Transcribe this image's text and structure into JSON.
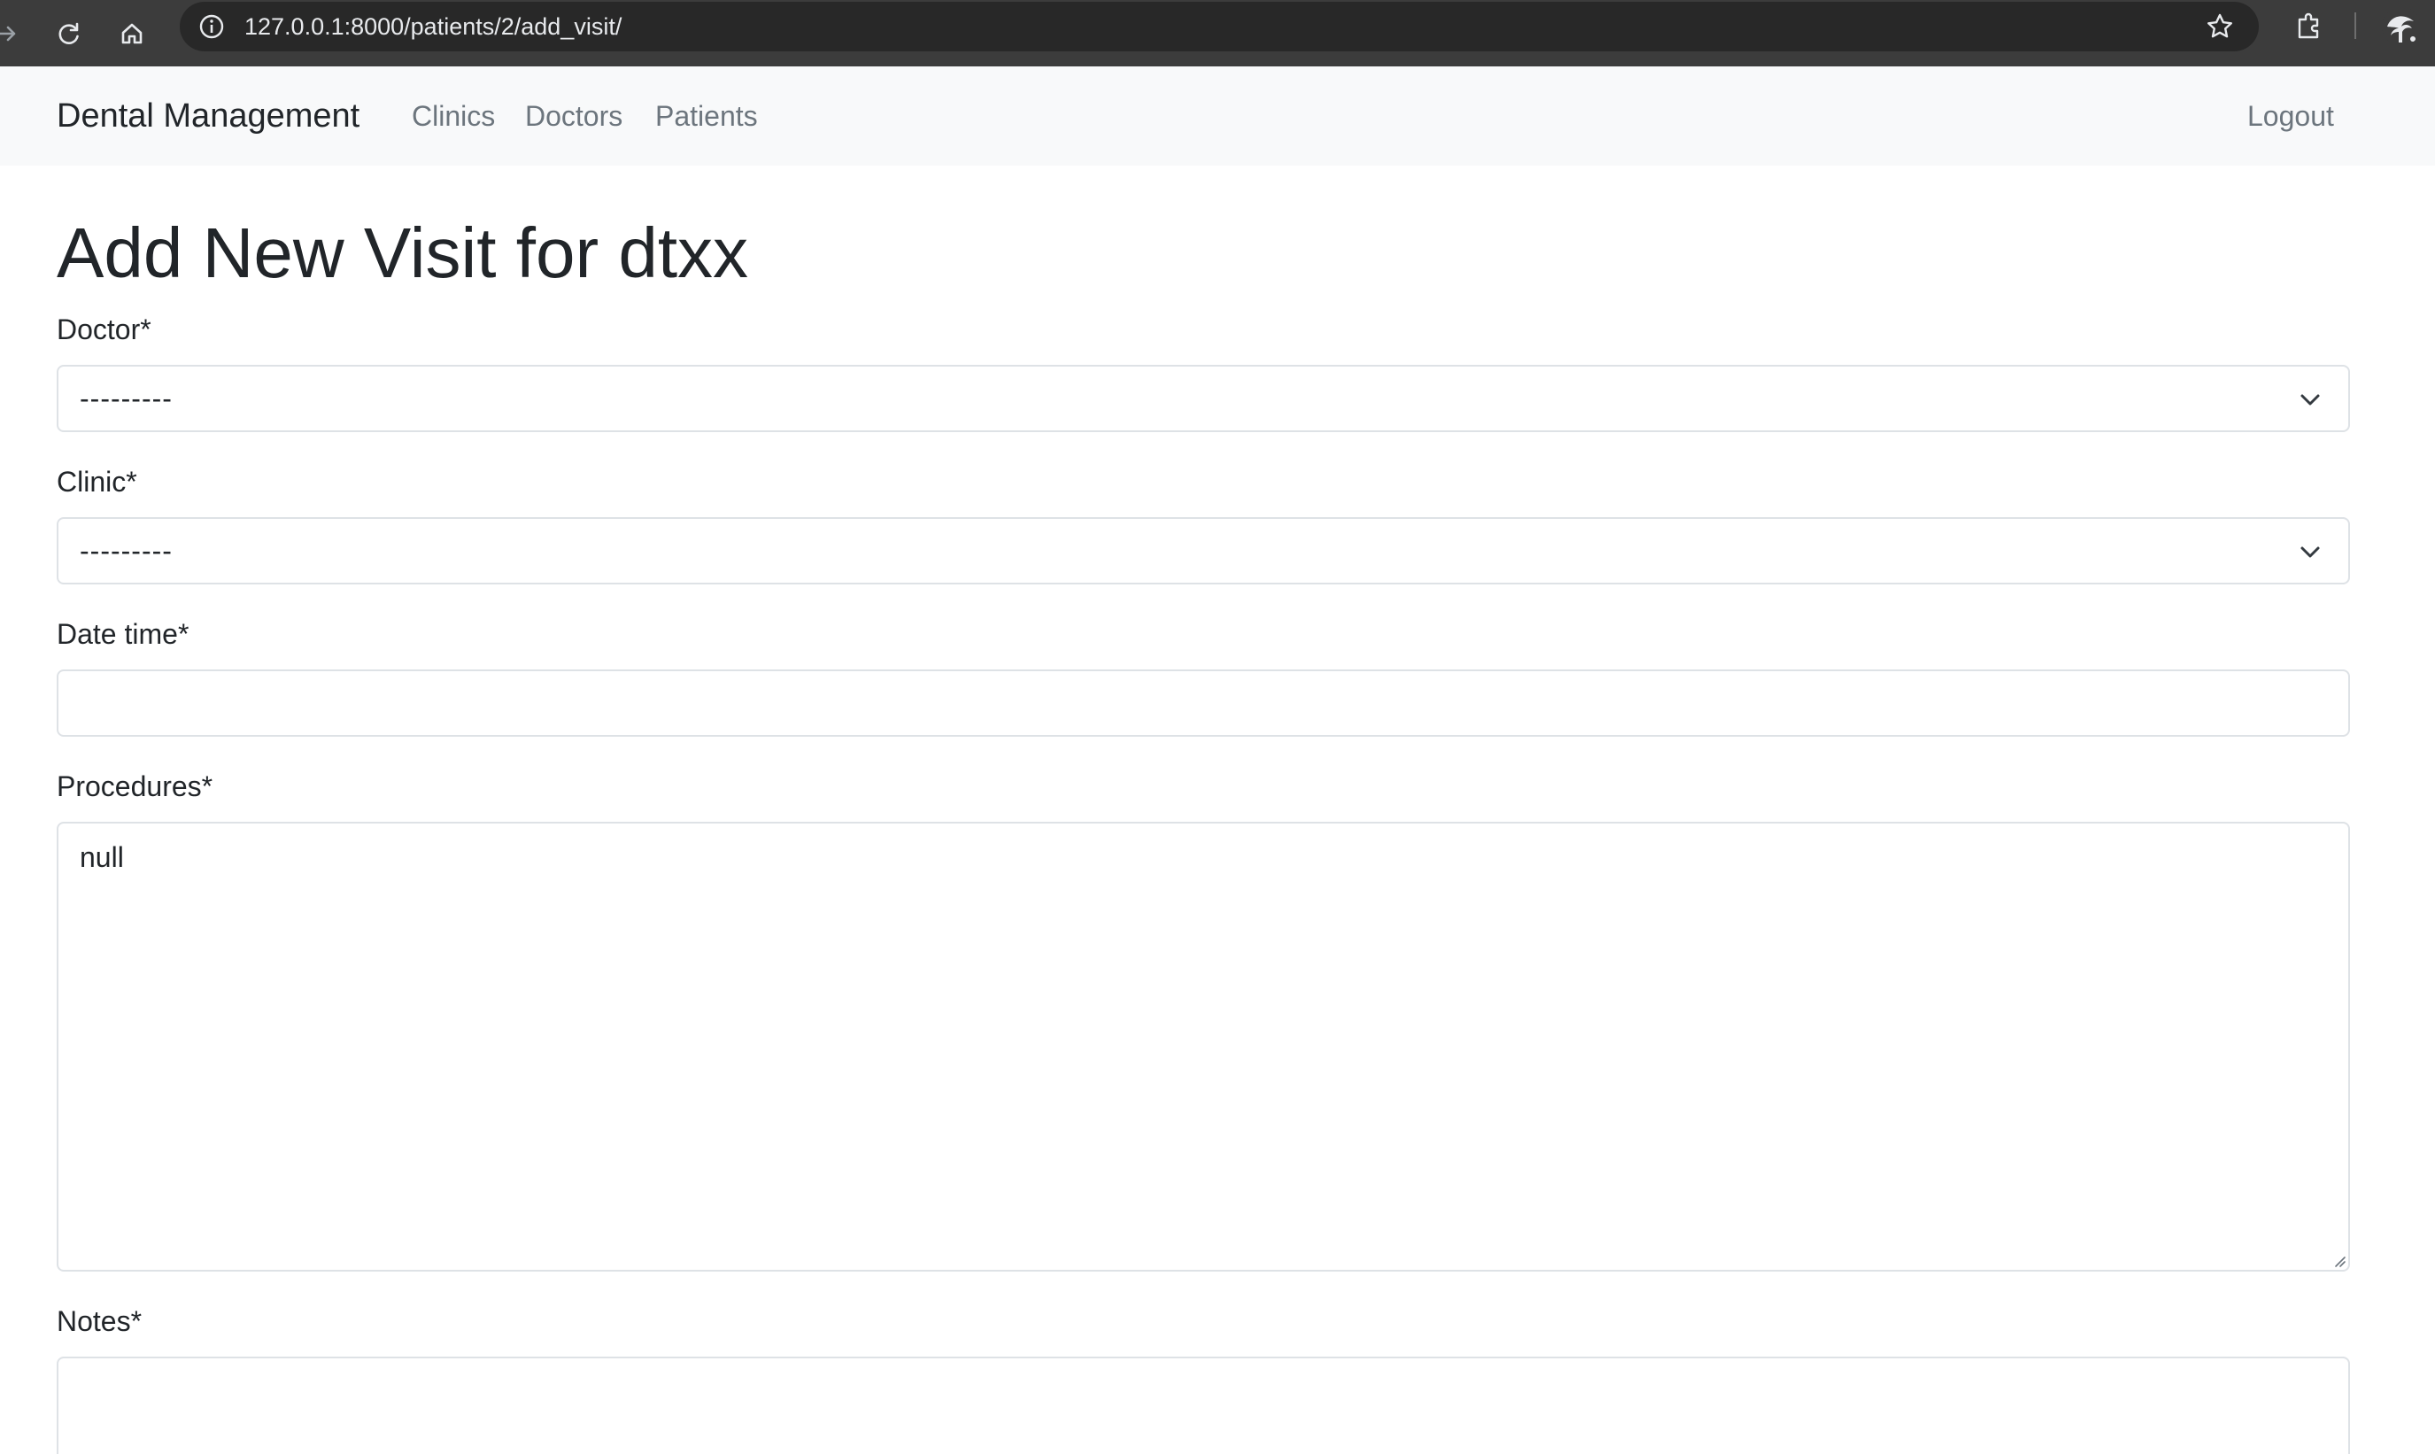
{
  "browser": {
    "url": "127.0.0.1:8000/patients/2/add_visit/",
    "icons": [
      "forward-icon",
      "reload-icon",
      "home-icon",
      "info-icon",
      "star-icon",
      "extensions-icon",
      "profile-icon"
    ]
  },
  "navbar": {
    "brand": "Dental Management",
    "links": [
      "Clinics",
      "Doctors",
      "Patients"
    ],
    "logout": "Logout"
  },
  "page": {
    "title": "Add New Visit for dtxx"
  },
  "form": {
    "doctor": {
      "label": "Doctor*",
      "value": "---------"
    },
    "clinic": {
      "label": "Clinic*",
      "value": "---------"
    },
    "date_time": {
      "label": "Date time*",
      "value": ""
    },
    "procedures": {
      "label": "Procedures*",
      "value": "null"
    },
    "notes": {
      "label": "Notes*",
      "value": ""
    }
  },
  "colors": {
    "chrome_bg": "#3c3c3c",
    "omnibox_bg": "#282828",
    "navbar_bg": "#f8f9fa",
    "nav_link": "#6c757d",
    "field_border": "#dee2e6",
    "text": "#212529"
  }
}
